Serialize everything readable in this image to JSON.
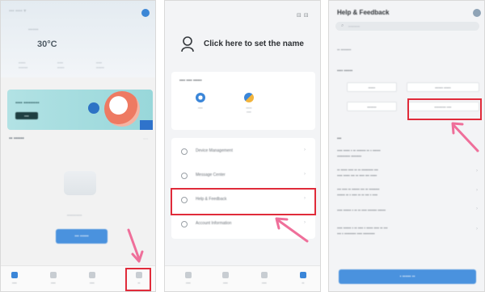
{
  "colors": {
    "accent_blue": "#3b86d8",
    "highlight_red": "#e02b3a",
    "arrow_pink": "#ef6f9a",
    "banner_teal": "#a6dcde"
  },
  "screen_home": {
    "temperature": "30°C"
  },
  "screen_profile": {
    "profile_name": "Click here to set the name",
    "menu_items": [
      {
        "label": "Device Management",
        "icon": "device-icon"
      },
      {
        "label": "Message Center",
        "icon": "message-icon"
      },
      {
        "label": "Help & Feedback",
        "icon": "help-icon"
      },
      {
        "label": "Account Information",
        "icon": "account-icon"
      }
    ]
  },
  "screen_help": {
    "title": "Help & Feedback"
  }
}
